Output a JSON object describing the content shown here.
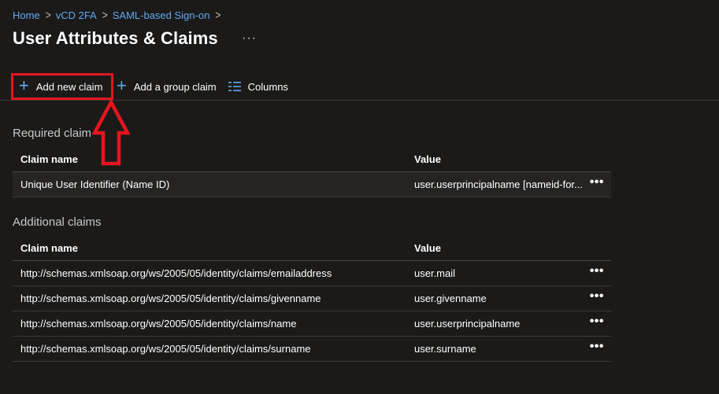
{
  "breadcrumb": {
    "items": [
      "Home",
      "vCD 2FA",
      "SAML-based Sign-on"
    ],
    "separator": ">"
  },
  "page": {
    "title": "User Attributes & Claims",
    "more": "···"
  },
  "toolbar": {
    "add_new_claim": "Add new claim",
    "add_group_claim": "Add a group claim",
    "columns": "Columns"
  },
  "required": {
    "title": "Required claim",
    "headers": {
      "name": "Claim name",
      "value": "Value"
    },
    "rows": [
      {
        "name": "Unique User Identifier (Name ID)",
        "value": "user.userprincipalname [nameid-for..."
      }
    ]
  },
  "additional": {
    "title": "Additional claims",
    "headers": {
      "name": "Claim name",
      "value": "Value"
    },
    "rows": [
      {
        "name": "http://schemas.xmlsoap.org/ws/2005/05/identity/claims/emailaddress",
        "value": "user.mail"
      },
      {
        "name": "http://schemas.xmlsoap.org/ws/2005/05/identity/claims/givenname",
        "value": "user.givenname"
      },
      {
        "name": "http://schemas.xmlsoap.org/ws/2005/05/identity/claims/name",
        "value": "user.userprincipalname"
      },
      {
        "name": "http://schemas.xmlsoap.org/ws/2005/05/identity/claims/surname",
        "value": "user.surname"
      }
    ]
  },
  "row_more": "•••",
  "colors": {
    "background": "#1b1a19",
    "link": "#62a8f0",
    "highlight_box": "#e3161e",
    "arrow": "#e3161e"
  },
  "icons": {
    "plus": "+",
    "columns": "columns-icon",
    "arrow": "up-arrow-annotation"
  }
}
